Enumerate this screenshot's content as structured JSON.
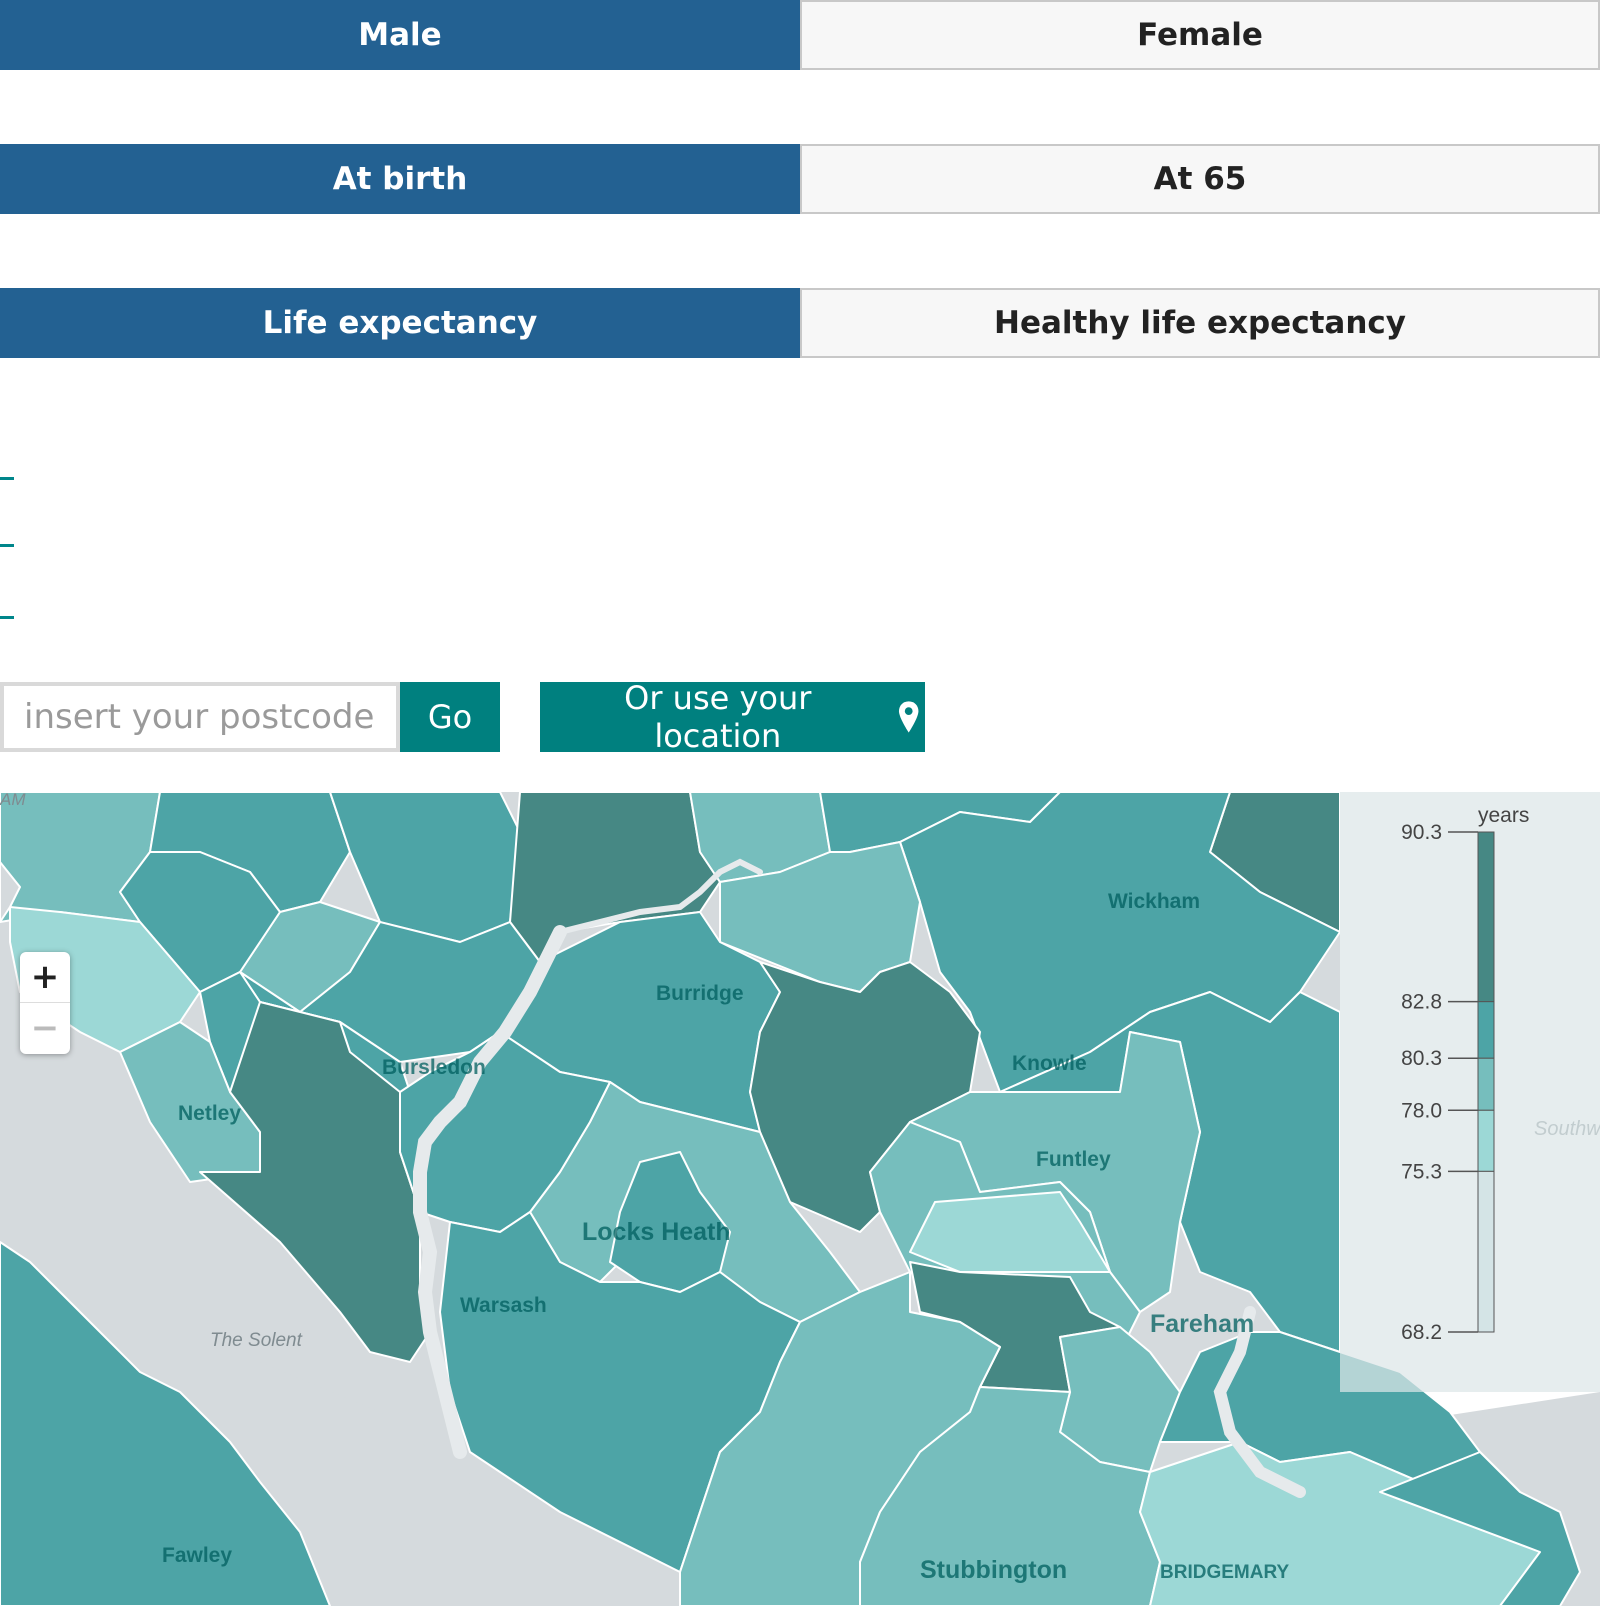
{
  "toggles": [
    {
      "left": "Male",
      "right": "Female"
    },
    {
      "left": "At birth",
      "right": "At 65"
    },
    {
      "left": "Life expectancy",
      "right": "Healthy life expectancy"
    }
  ],
  "summary_lines": [
    "-",
    "-",
    "-"
  ],
  "search": {
    "placeholder": "insert your postcode",
    "go_label": "Go",
    "location_label": "Or use your location",
    "location_icon": "map-pin-icon"
  },
  "map": {
    "zoom_in": "+",
    "zoom_out": "−",
    "places": [
      "Wickham",
      "Burridge",
      "Bursledon",
      "Knowle",
      "Netley",
      "Funtley",
      "Locks Heath",
      "Warsash",
      "Fareham",
      "The Solent",
      "Fawley",
      "Stubbington",
      "BRIDGEMARY",
      "AM",
      "Southw"
    ],
    "legend": {
      "unit": "years",
      "ticks": [
        90.3,
        82.8,
        80.3,
        78.0,
        75.3,
        68.2
      ],
      "tick_labels": [
        "90.3",
        "82.8",
        "80.3",
        "78.0",
        "75.3",
        "68.2"
      ],
      "colors": [
        "#468884",
        "#4da4a6",
        "#76bebd",
        "#9cd8d6",
        "#d4e4e6"
      ]
    }
  }
}
